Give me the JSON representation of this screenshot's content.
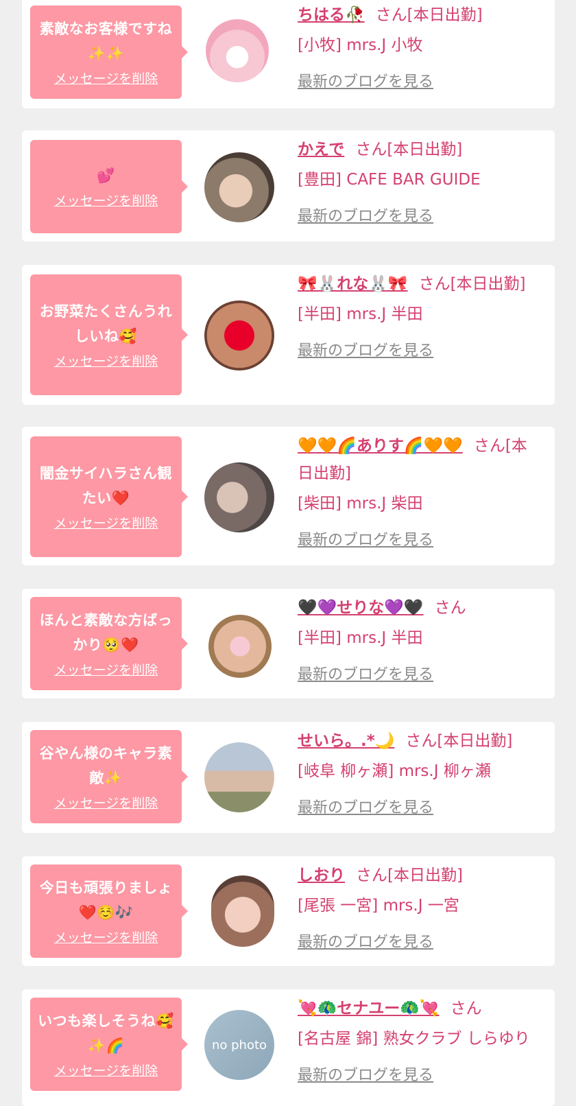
{
  "entries": [
    {
      "message": "素敵なお客様ですね✨✨",
      "delete_label": "メッセージを削除",
      "name": "ちはる🥀",
      "honorific": "さん[本日出勤]",
      "shop": "[小牧] mrs.J 小牧",
      "blog_link": "最新のブログを見る",
      "avatar_icon": "plush-bunny-photo"
    },
    {
      "message": "💕",
      "delete_label": "メッセージを削除",
      "name": "かえで",
      "honorific": "さん[本日出勤]",
      "shop": "[豊田] CAFE BAR GUIDE",
      "blog_link": "最新のブログを見る",
      "avatar_icon": "girl-photo"
    },
    {
      "message": "お野菜たくさんうれしいね🥰",
      "delete_label": "メッセージを削除",
      "name": "🎀🐰れな🐰🎀",
      "honorific": "さん[本日出勤]",
      "shop": "[半田] mrs.J 半田",
      "blog_link": "最新のブログを見る",
      "avatar_icon": "heart-face-photo"
    },
    {
      "message": "闇金サイハラさん観たい❤️",
      "delete_label": "メッセージを削除",
      "name": "🧡🧡🌈ありす🌈🧡🧡",
      "honorific": "さん[本日出勤]",
      "shop": "[柴田] mrs.J 柴田",
      "blog_link": "最新のブログを見る",
      "avatar_icon": "woman-photo"
    },
    {
      "message": "ほんと素敵な方ばっかり🥺❤️",
      "delete_label": "メッセージを削除",
      "name": "🖤💜せりな💜🖤",
      "honorific": "さん",
      "shop": "[半田] mrs.J 半田",
      "blog_link": "最新のブログを見る",
      "avatar_icon": "blonde-photo"
    },
    {
      "message": "谷やん様のキャラ素敵✨",
      "delete_label": "メッセージを削除",
      "name": "せいら。.*🌙",
      "honorific": "さん[本日出勤]",
      "shop": "[岐阜 柳ヶ瀬] mrs.J 柳ヶ瀬",
      "blog_link": "最新のブログを見る",
      "avatar_icon": "outdoor-photo"
    },
    {
      "message": "今日も頑張りましょ❤️☺️🎶",
      "delete_label": "メッセージを削除",
      "name": "しおり",
      "honorific": "さん[本日出勤]",
      "shop": "[尾張 一宮] mrs.J 一宮",
      "blog_link": "最新のブログを見る",
      "avatar_icon": "selfie-photo"
    },
    {
      "message": "いつも楽しそうね🥰✨🌈",
      "delete_label": "メッセージを削除",
      "name": "💘🦚セナユー🦚💘",
      "honorific": "さん",
      "shop": "[名古屋 錦] 熟女クラブ しらゆり",
      "blog_link": "最新のブログを見る",
      "avatar_icon": "no-photo",
      "avatar_text": "no photo"
    }
  ]
}
